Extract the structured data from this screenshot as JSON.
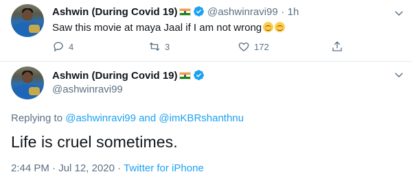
{
  "tweet1": {
    "author_name": "Ashwin (During Covid 19)",
    "handle": "@ashwinravi99",
    "separator": "·",
    "time": "1h",
    "text": "Saw this movie at maya Jaal if I am not wrong",
    "replies": "4",
    "retweets": "3",
    "likes": "172"
  },
  "tweet2": {
    "author_name": "Ashwin (During Covid 19)",
    "handle": "@ashwinravi99",
    "replying_prefix": "Replying to",
    "replying_user1": "@ashwinravi99",
    "replying_and": "and",
    "replying_user2": "@imKBRshanthnu",
    "text": "Life is cruel sometimes.",
    "time": "2:44 PM",
    "dot": "·",
    "date": "Jul 12, 2020",
    "source": "Twitter for iPhone"
  },
  "colors": {
    "accent": "#1da1f2",
    "muted": "#5b7083",
    "text": "#0f1419"
  },
  "icons": [
    "flag-india-icon",
    "verified-badge-icon",
    "chevron-down-icon",
    "reply-icon",
    "retweet-icon",
    "like-icon",
    "share-icon",
    "relieved-face-emoji"
  ]
}
